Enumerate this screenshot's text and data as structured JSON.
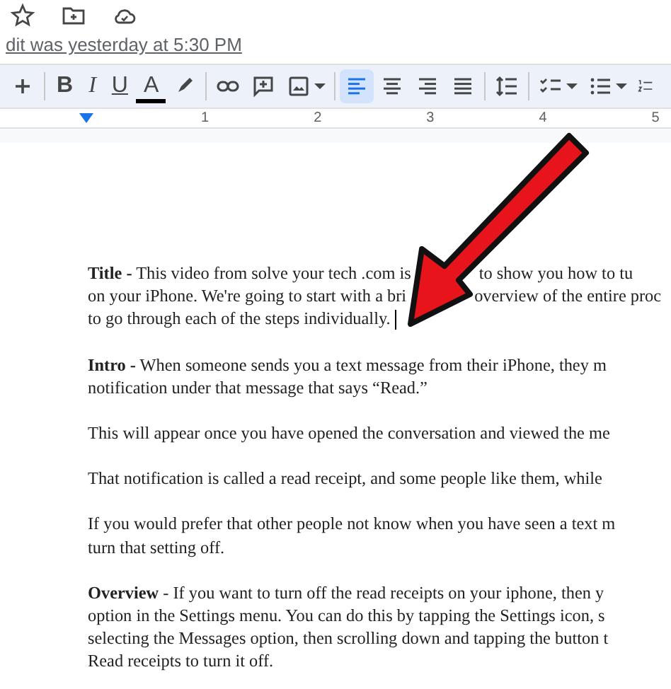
{
  "header": {
    "last_edit": "dit was yesterday at 5:30 PM"
  },
  "toolbar": [
    {
      "kind": "plus"
    },
    {
      "kind": "separator"
    },
    {
      "kind": "bold",
      "label": "B"
    },
    {
      "kind": "italic",
      "label": "I"
    },
    {
      "kind": "underline",
      "label": "U"
    },
    {
      "kind": "textcolor",
      "label": "A"
    },
    {
      "kind": "highlighter"
    },
    {
      "kind": "separator"
    },
    {
      "kind": "link"
    },
    {
      "kind": "comment"
    },
    {
      "kind": "image"
    },
    {
      "kind": "separator"
    },
    {
      "kind": "alignleft",
      "selected": true
    },
    {
      "kind": "aligncenter",
      "selected": false
    },
    {
      "kind": "alignright",
      "selected": false
    },
    {
      "kind": "justify",
      "selected": false
    },
    {
      "kind": "separator"
    },
    {
      "kind": "spacing"
    },
    {
      "kind": "separator"
    },
    {
      "kind": "checklist"
    },
    {
      "kind": "bullets"
    },
    {
      "kind": "numbers"
    }
  ],
  "ruler": {
    "numbers": [
      "1",
      "2",
      "3",
      "4",
      "5"
    ]
  },
  "document": {
    "paragraphs": [
      {
        "lines": [
          [
            "**Title -**  This video from solve your tech .com is",
            "to show you how to tu"
          ],
          [
            "on your iPhone. We're going to start with a bri",
            "overview of the entire proc"
          ],
          [
            "to go through each of the steps individually."
          ]
        ],
        "cursor": true
      },
      {
        "lines": [
          [
            "**Intro -** When someone sends you a text message from their iPhone, they m"
          ],
          [
            "notification under that message that says “Read.”"
          ]
        ]
      },
      {
        "lines": [
          [
            "This will appear once you have opened the conversation and viewed the me"
          ]
        ]
      },
      {
        "lines": [
          [
            "That notification is called a read receipt, and some people like them, while"
          ]
        ]
      },
      {
        "lines": [
          [
            "If you would prefer that other people not know when you have seen a text m"
          ],
          [
            "turn that setting off."
          ]
        ]
      },
      {
        "lines": [
          [
            "**Overview** - If you want to turn off the read receipts on your iphone, then y"
          ],
          [
            "option in the Settings menu. You can do this by tapping the Settings icon, s"
          ],
          [
            "selecting the Messages option, then scrolling down and tapping the button t"
          ],
          [
            "Read receipts to turn it off."
          ]
        ]
      }
    ]
  }
}
